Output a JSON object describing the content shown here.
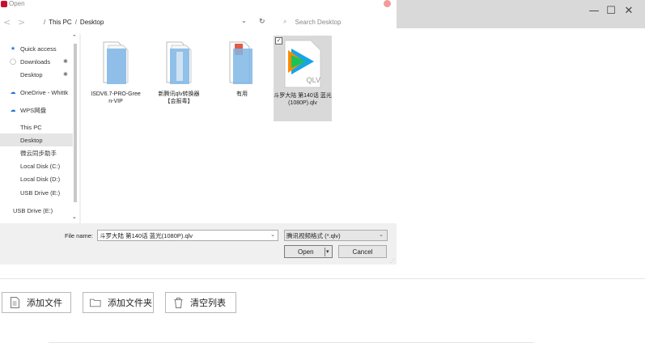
{
  "app": {
    "window_controls": {
      "minimize": "—",
      "maximize": "☐",
      "close": "✕"
    },
    "toolbar": {
      "add_file": "添加文件",
      "add_folder": "添加文件夹",
      "clear_list": "清空列表"
    }
  },
  "dialog": {
    "title": "Open",
    "breadcrumb": [
      "This PC",
      "Desktop"
    ],
    "search_placeholder": "Search Desktop",
    "sidebar": {
      "items": [
        {
          "label": "Quick access",
          "icon": "star-icon",
          "pin": ""
        },
        {
          "label": "Downloads",
          "icon": "download-icon",
          "pin": "✱"
        },
        {
          "label": "Desktop",
          "icon": "",
          "pin": "✱"
        },
        {
          "label": "OneDrive - Whittk",
          "icon": "cloud-icon",
          "pin": ""
        },
        {
          "label": "WPS网盘",
          "icon": "wps-cloud-icon",
          "pin": ""
        },
        {
          "label": "This PC",
          "icon": "",
          "pin": ""
        },
        {
          "label": "Desktop",
          "icon": "",
          "pin": ""
        },
        {
          "label": "微云同步助手",
          "icon": "",
          "pin": ""
        },
        {
          "label": "Local Disk (C:)",
          "icon": "",
          "pin": ""
        },
        {
          "label": "Local Disk (D:)",
          "icon": "",
          "pin": ""
        },
        {
          "label": "USB Drive (E:)",
          "icon": "",
          "pin": ""
        },
        {
          "label": "USB Drive (E:)",
          "icon": "",
          "pin": ""
        }
      ]
    },
    "files": [
      {
        "name": "ISDV6.7-PRO-Green-VIP",
        "type": "folder"
      },
      {
        "name": "新腾讯qlv转换器【会报毒】",
        "type": "folder"
      },
      {
        "name": "有用",
        "type": "folder"
      },
      {
        "name": "斗罗大陆 第140话 蓝光(1080P).qlv",
        "type": "qlv",
        "selected": true
      }
    ],
    "qlv_badge": "QLV",
    "file_name_label": "File name:",
    "file_name_value": "斗罗大陆 第140话 蓝光(1080P).qlv",
    "file_type_value": "腾讯视频格式 (*.qlv)",
    "open_label": "Open",
    "cancel_label": "Cancel"
  }
}
